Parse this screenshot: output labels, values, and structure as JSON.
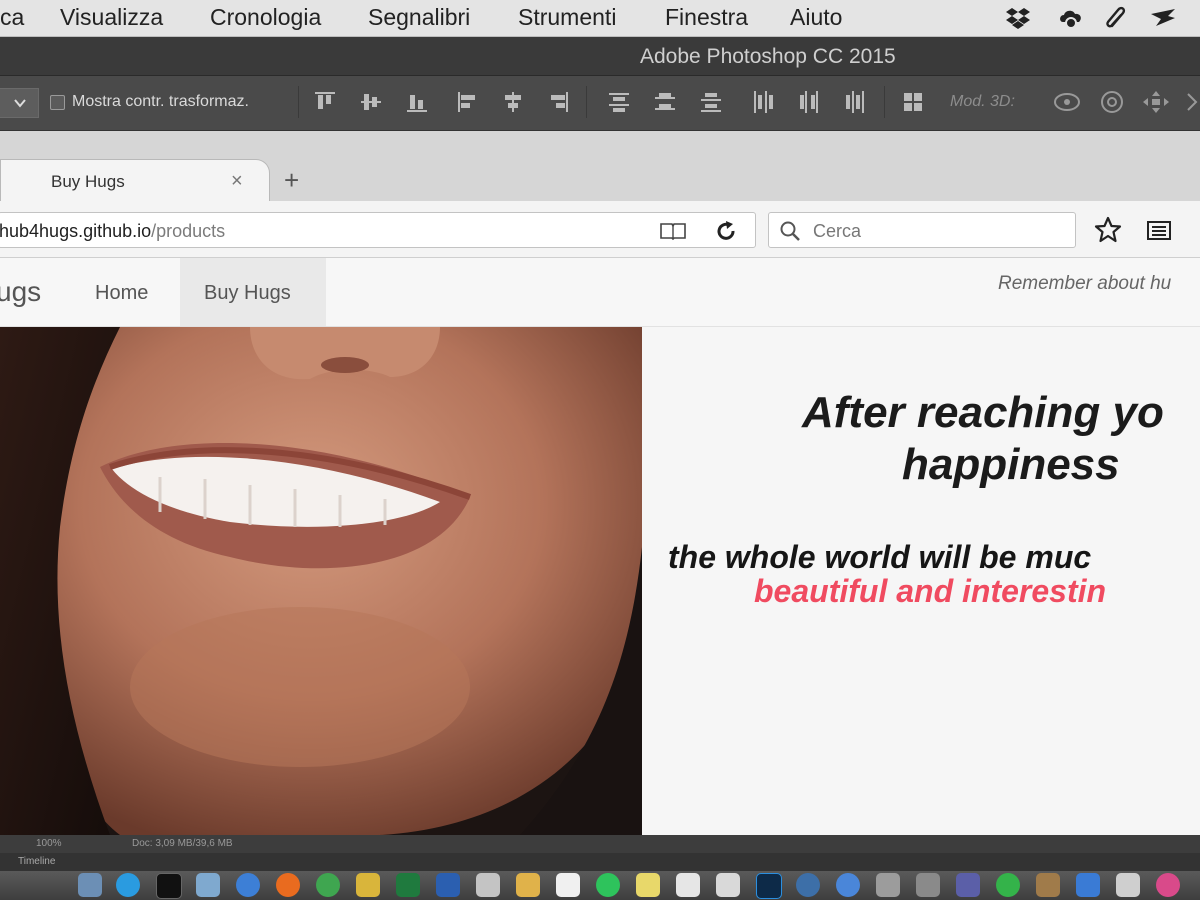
{
  "menubar": {
    "items": [
      "ca",
      "Visualizza",
      "Cronologia",
      "Segnalibri",
      "Strumenti",
      "Finestra",
      "Aiuto"
    ],
    "tray_icons": [
      "dropbox-icon",
      "creative-cloud-icon",
      "attachment-icon",
      "sync-icon"
    ]
  },
  "photoshop": {
    "title": "Adobe Photoshop CC 2015",
    "options": {
      "show_transform_label": "Mostra contr. trasformaz.",
      "mode_3d_label": "Mod. 3D:"
    },
    "status": {
      "zoom": "100%",
      "doc": "Doc: 3,09 MB/39,6 MB"
    },
    "timeline_label": "Timeline"
  },
  "browser": {
    "tab_title": "Buy Hugs",
    "tab_close": "×",
    "new_tab": "+",
    "url_host": "hub4hugs.github.io",
    "url_path": "/products",
    "search_placeholder": "Cerca"
  },
  "site": {
    "brand": "ugs",
    "nav": {
      "home": "Home",
      "buy": "Buy Hugs"
    },
    "tagline": "Remember about hu",
    "headline_line1": "After reaching yo",
    "headline_line2": "happiness",
    "sub_line1": "the whole world will be muc",
    "sub_line2": "beautiful and interestin",
    "accent_color": "#f04b60"
  }
}
